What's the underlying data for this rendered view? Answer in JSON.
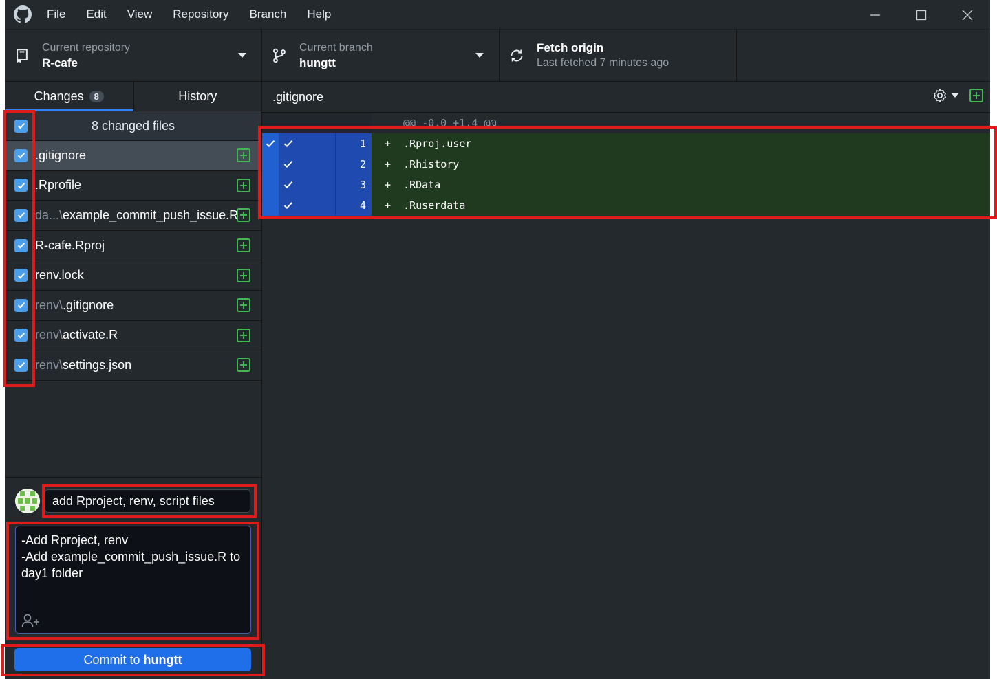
{
  "menu": [
    "File",
    "Edit",
    "View",
    "Repository",
    "Branch",
    "Help"
  ],
  "toolbar": {
    "repo": {
      "sub": "Current repository",
      "main": "R-cafe"
    },
    "branch": {
      "sub": "Current branch",
      "main": "hungtt"
    },
    "fetch": {
      "main": "Fetch origin",
      "sub": "Last fetched 7 minutes ago"
    }
  },
  "tabs": {
    "changes": "Changes",
    "changes_count": "8",
    "history": "History"
  },
  "changes": {
    "header": "8 changed files",
    "files": [
      {
        "dir": "",
        "name": ".gitignore"
      },
      {
        "dir": "",
        "name": ".Rprofile"
      },
      {
        "dir": "da...\\",
        "name": "example_commit_push_issue.R"
      },
      {
        "dir": "",
        "name": "R-cafe.Rproj"
      },
      {
        "dir": "",
        "name": "renv.lock"
      },
      {
        "dir": "renv\\",
        "name": ".gitignore"
      },
      {
        "dir": "renv\\",
        "name": "activate.R"
      },
      {
        "dir": "renv\\",
        "name": "settings.json"
      }
    ]
  },
  "commit": {
    "summary": "add Rproject, renv, script files",
    "description": "-Add Rproject, renv\n-Add example_commit_push_issue.R to day1 folder",
    "button_prefix": "Commit to",
    "button_branch": "hungtt"
  },
  "diff": {
    "file": ".gitignore",
    "hunk": "@@ -0,0 +1,4 @@",
    "lines": [
      {
        "num": "1",
        "code": "+  .Rproj.user"
      },
      {
        "num": "2",
        "code": "+  .Rhistory"
      },
      {
        "num": "3",
        "code": "+  .RData"
      },
      {
        "num": "4",
        "code": "+  .Ruserdata"
      }
    ]
  },
  "colors": {
    "app_bg": "#24292e",
    "accent": "#1f6feb",
    "added_line_bg": "#1f3a1f",
    "annotation_red": "#e01b1b"
  }
}
